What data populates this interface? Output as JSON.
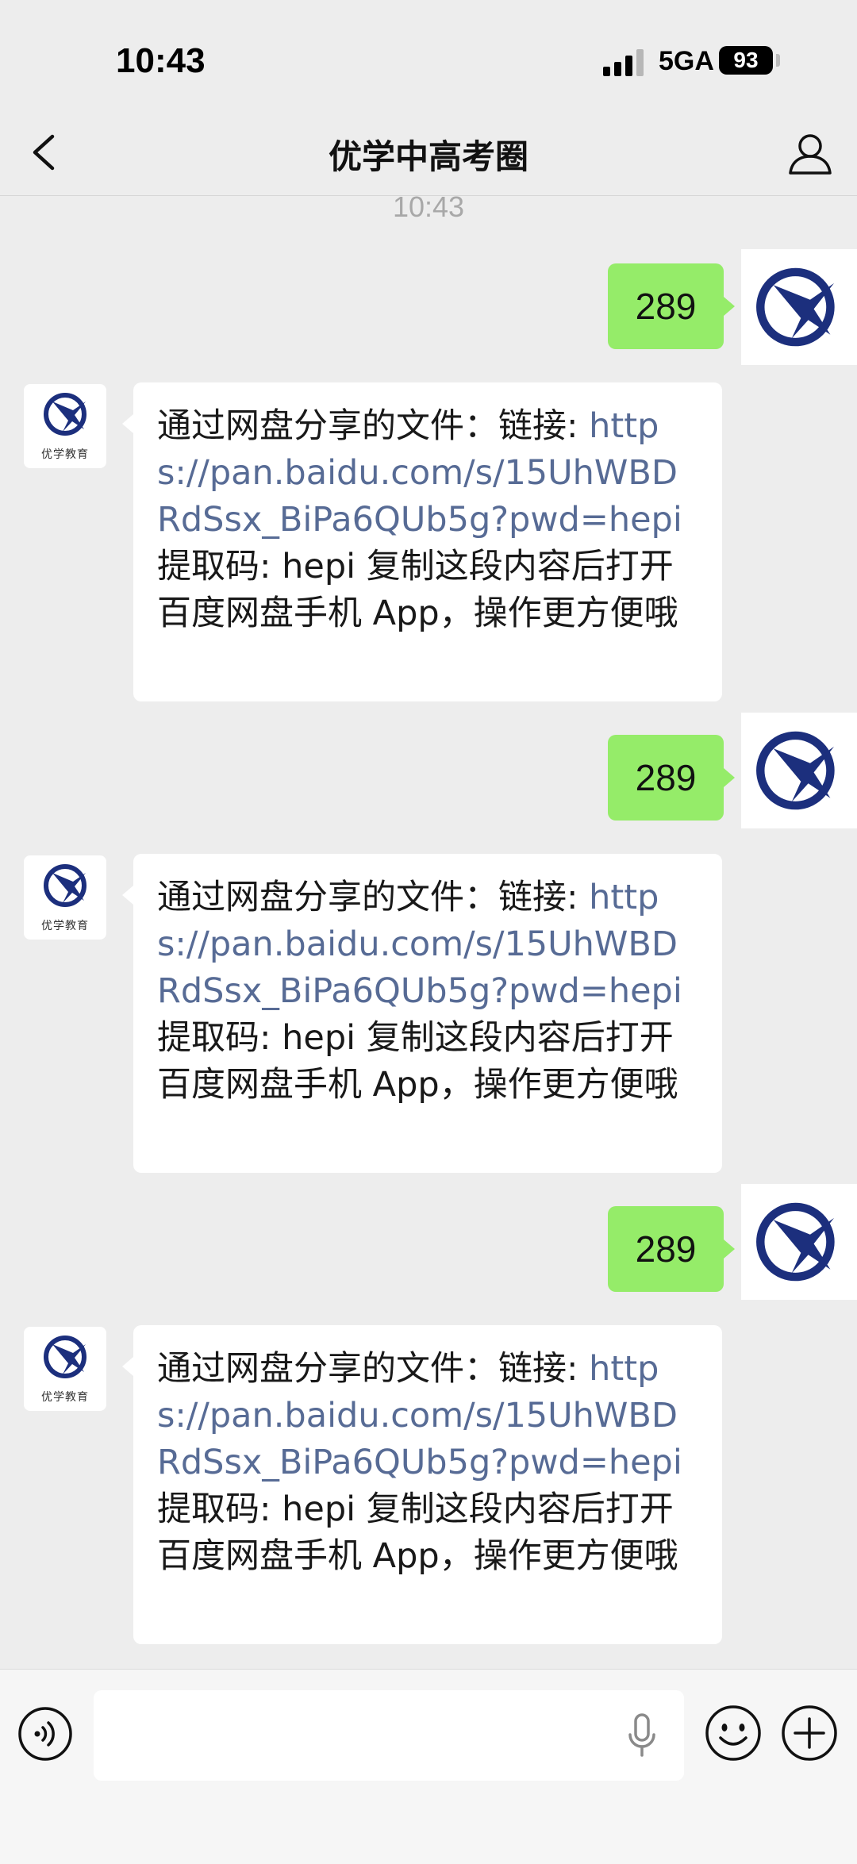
{
  "status_bar": {
    "time": "10:43",
    "network": "5GA",
    "battery": "93"
  },
  "nav": {
    "title": "优学中高考圈"
  },
  "chat": {
    "timestamp": "10:43",
    "messages": [
      {
        "side": "right",
        "text": "289"
      },
      {
        "side": "left",
        "text_before_link": "通过网盘分享的文件：链接: ",
        "link": "https://pan.baidu.com/s/15UhWBDRdSsx_BiPa6QUb5g?pwd=hepi",
        "text_after_link": " 提取码: hepi 复制这段内容后打开百度网盘手机 App，操作更方便哦"
      },
      {
        "side": "right",
        "text": "289"
      },
      {
        "side": "left",
        "text_before_link": "通过网盘分享的文件：链接: ",
        "link": "https://pan.baidu.com/s/15UhWBDRdSsx_BiPa6QUb5g?pwd=hepi",
        "text_after_link": " 提取码: hepi 复制这段内容后打开百度网盘手机 App，操作更方便哦"
      },
      {
        "side": "right",
        "text": "289"
      },
      {
        "side": "left",
        "text_before_link": "通过网盘分享的文件：链接: ",
        "link": "https://pan.baidu.com/s/15UhWBDRdSsx_BiPa6QUb5g?pwd=hepi",
        "text_after_link": " 提取码: hepi 复制这段内容后打开百度网盘手机 App，操作更方便哦"
      }
    ],
    "contact_avatar_caption": "优学教育"
  },
  "input_bar": {
    "value": ""
  },
  "colors": {
    "sent_bubble": "#95ec69",
    "link": "#576b95",
    "logo_blue": "#1c2f7d"
  },
  "icons": [
    "back-arrow-icon",
    "person-icon",
    "voice-icon",
    "microphone-icon",
    "emoji-icon",
    "plus-icon",
    "brand-logo-icon"
  ]
}
